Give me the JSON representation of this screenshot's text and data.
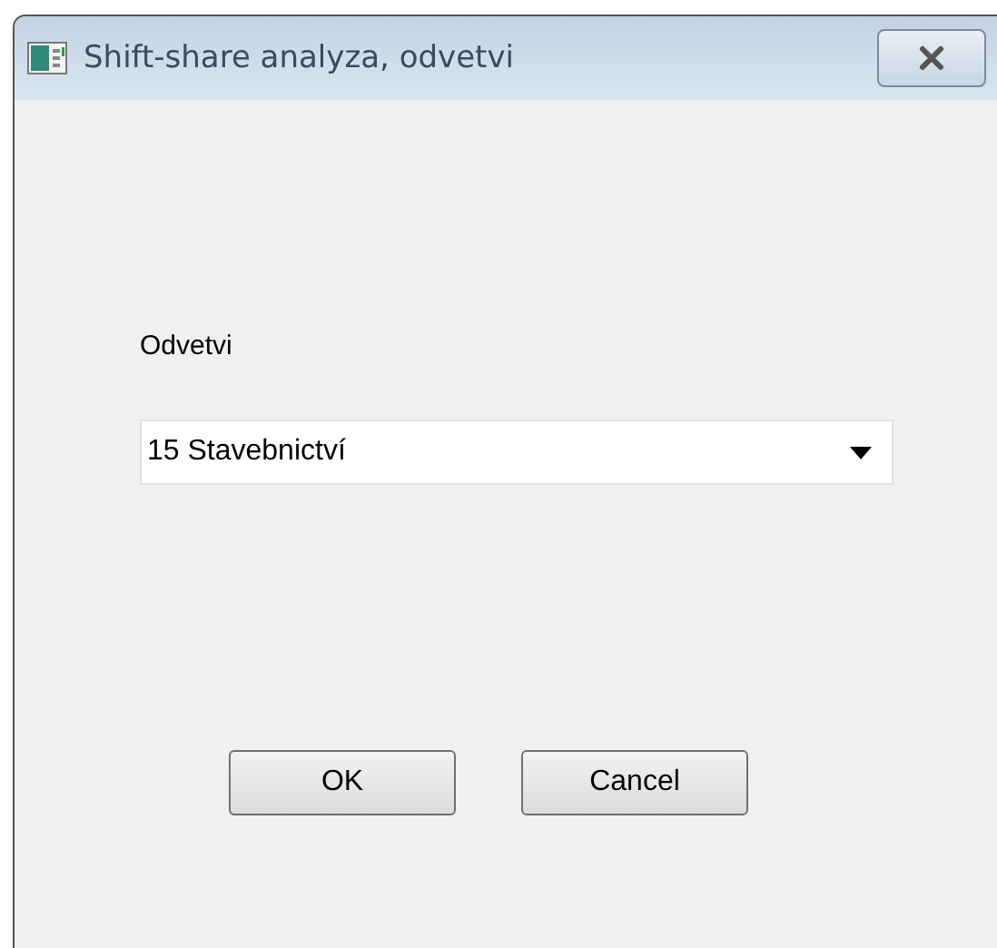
{
  "window": {
    "title": "Shift-share analyza, odvetvi"
  },
  "field": {
    "label": "Odvetvi",
    "value": "15 Stavebnictví"
  },
  "buttons": [
    "OK",
    "Cancel"
  ]
}
